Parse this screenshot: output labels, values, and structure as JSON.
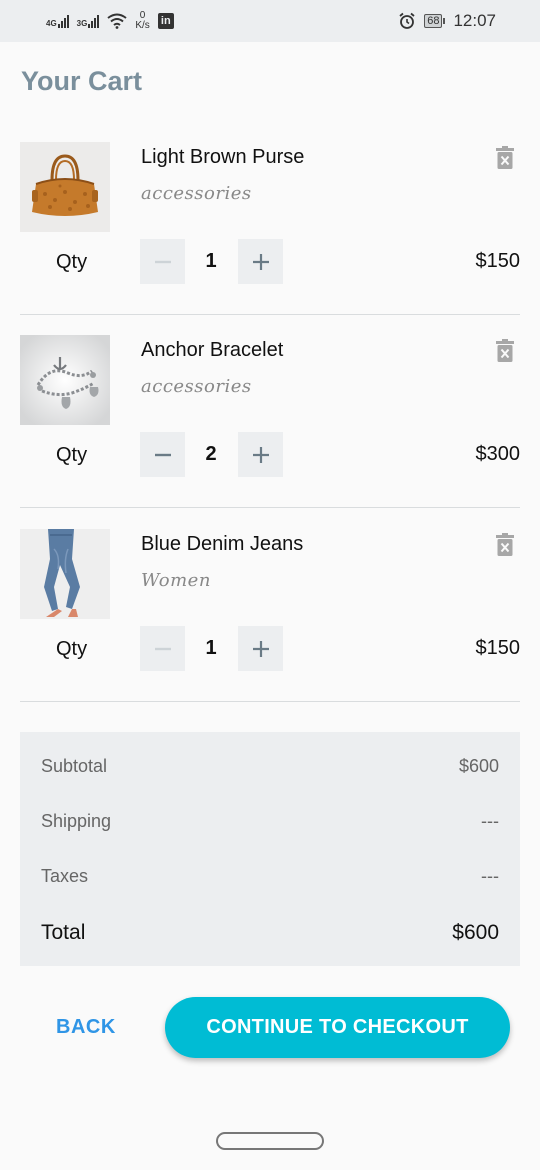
{
  "status_bar": {
    "net1": "4G",
    "net2": "3G",
    "speed_value": "0",
    "speed_unit": "K/s",
    "linkedin": "in",
    "battery": "68",
    "time": "12:07"
  },
  "page": {
    "title": "Your Cart"
  },
  "qty_label": "Qty",
  "items": [
    {
      "name": "Light Brown Purse",
      "category": "accessories",
      "quantity": "1",
      "price": "$150"
    },
    {
      "name": "Anchor Bracelet",
      "category": "accessories",
      "quantity": "2",
      "price": "$300"
    },
    {
      "name": "Blue Denim Jeans",
      "category": "Women",
      "quantity": "1",
      "price": "$150"
    }
  ],
  "summary": {
    "subtotal_label": "Subtotal",
    "subtotal_value": "$600",
    "shipping_label": "Shipping",
    "shipping_value": "---",
    "taxes_label": "Taxes",
    "taxes_value": "---",
    "total_label": "Total",
    "total_value": "$600"
  },
  "actions": {
    "back_label": "BACK",
    "checkout_label": "CONTINUE TO CHECKOUT"
  },
  "colors": {
    "title": "#7a8f9c",
    "accent": "#00bcd4",
    "link": "#2f95e6",
    "panel": "#eceef0"
  },
  "icons": [
    "trash-icon",
    "minus-icon",
    "plus-icon",
    "wifi-icon",
    "alarm-icon",
    "battery-icon",
    "linkedin-icon"
  ]
}
